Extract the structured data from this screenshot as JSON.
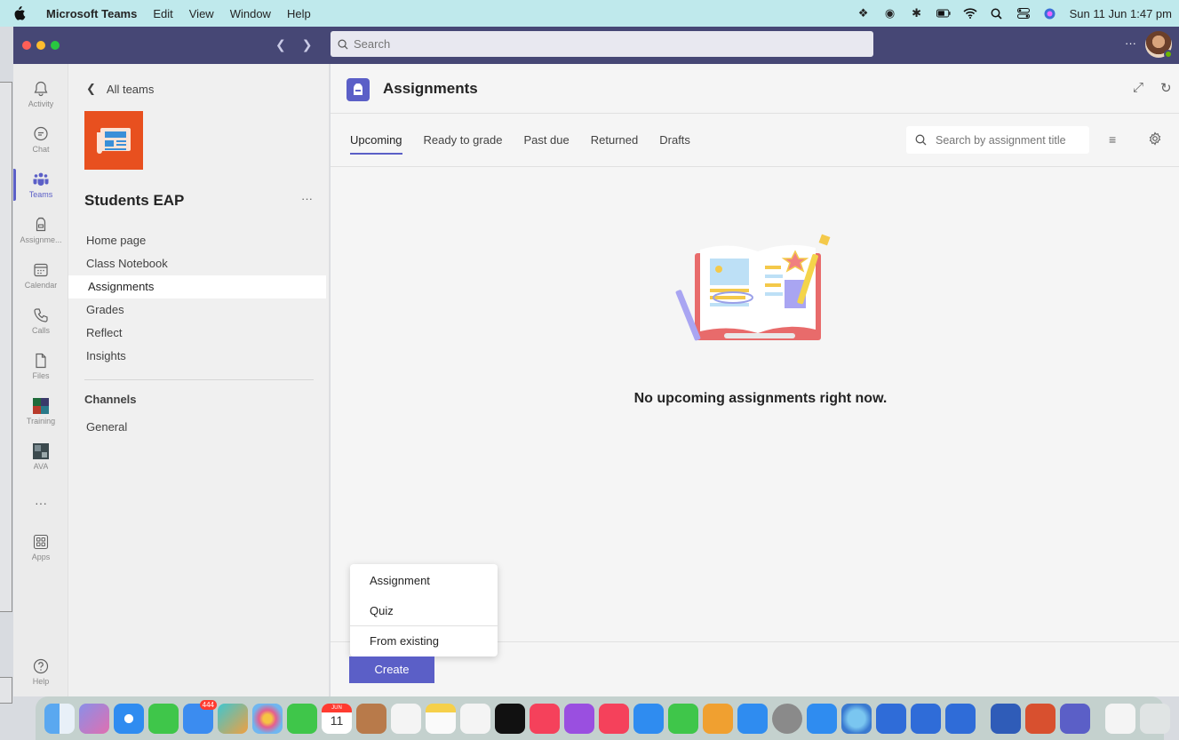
{
  "menubar": {
    "app": "Microsoft Teams",
    "items": [
      "Edit",
      "View",
      "Window",
      "Help"
    ],
    "clock": "Sun 11 Jun  1:47 pm"
  },
  "titlebar": {
    "search_placeholder": "Search",
    "more": "···"
  },
  "rail": {
    "items": [
      {
        "label": "Activity"
      },
      {
        "label": "Chat"
      },
      {
        "label": "Teams"
      },
      {
        "label": "Assignme..."
      },
      {
        "label": "Calendar"
      },
      {
        "label": "Calls"
      },
      {
        "label": "Files"
      },
      {
        "label": "Training"
      },
      {
        "label": "AVA"
      },
      {
        "label": "···"
      },
      {
        "label": "Apps"
      },
      {
        "label": "Help"
      }
    ]
  },
  "teampane": {
    "back": "All teams",
    "team_name": "Students EAP",
    "more": "···",
    "nav": [
      "Home page",
      "Class Notebook",
      "Assignments",
      "Grades",
      "Reflect",
      "Insights"
    ],
    "channels_heading": "Channels",
    "channels": [
      "General"
    ]
  },
  "main": {
    "title": "Assignments",
    "tabs": [
      "Upcoming",
      "Ready to grade",
      "Past due",
      "Returned",
      "Drafts"
    ],
    "search_placeholder": "Search by assignment title",
    "empty_message": "No upcoming assignments right now.",
    "create_menu": [
      "Assignment",
      "Quiz",
      "From existing"
    ],
    "create_label": "Create"
  },
  "dock": {
    "mail_badge": "444",
    "calendar_month": "JUN",
    "calendar_day": "11"
  },
  "colors": {
    "brand": "#464775",
    "accent": "#5b5fc7",
    "menubar": "#bfe9ec",
    "team_logo": "#e8501f"
  }
}
